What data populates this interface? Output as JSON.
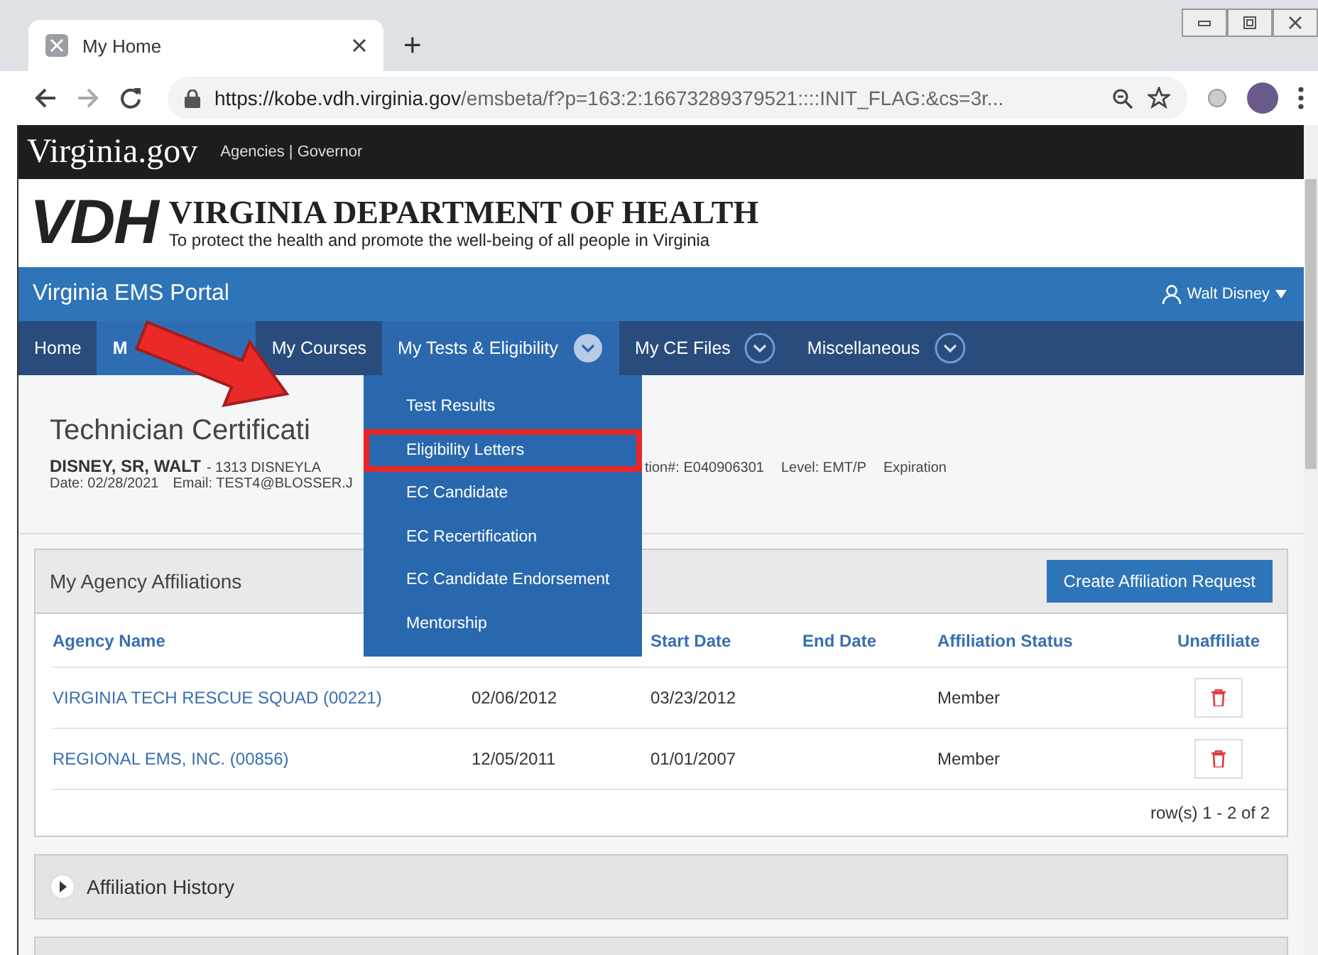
{
  "browser": {
    "tab_title": "My Home",
    "new_tab": "+",
    "url_host": "https://kobe.vdh.virginia.gov",
    "url_path": "/emsbeta/f?p=163:2:16673289379521::::INIT_FLAG:&cs=3r..."
  },
  "top_bar": {
    "logo": "Virginia.gov",
    "links": "Agencies | Governor"
  },
  "header": {
    "logo": "VDH",
    "title": "VIRGINIA DEPARTMENT OF HEALTH",
    "tagline": "To protect the health and promote the well-being of all people in Virginia"
  },
  "portal": {
    "title": "Virginia EMS Portal",
    "user": "Walt Disney"
  },
  "nav": [
    {
      "label": "Home",
      "selected": false,
      "has_menu": false,
      "expanded": false
    },
    {
      "label": "M",
      "selected": true,
      "has_menu": false,
      "expanded": false
    },
    {
      "label": "My Courses",
      "selected": false,
      "has_menu": false,
      "expanded": false
    },
    {
      "label": "My Tests & Eligibility",
      "selected": false,
      "has_menu": true,
      "expanded": true
    },
    {
      "label": "My CE Files",
      "selected": false,
      "has_menu": true,
      "expanded": false
    },
    {
      "label": "Miscellaneous",
      "selected": false,
      "has_menu": true,
      "expanded": false
    }
  ],
  "menu": {
    "items": [
      {
        "label": "Test Results",
        "annotated": false
      },
      {
        "label": "Eligibility Letters",
        "annotated": true
      },
      {
        "label": "EC Candidate",
        "annotated": false
      },
      {
        "label": "EC Recertification",
        "annotated": false
      },
      {
        "label": "EC Candidate Endorsement",
        "annotated": false
      },
      {
        "label": "Mentorship",
        "annotated": false
      }
    ]
  },
  "page": {
    "title": "Technician Certificati",
    "name": "DISNEY, SR, WALT",
    "address": "- 1313 DISNEYLA",
    "details": [
      "tion#: E040906301",
      "Level: EMT/P",
      "Expiration"
    ],
    "date": "Date: 02/28/2021",
    "email": "Email: TEST4@BLOSSER.J"
  },
  "affiliations": {
    "title": "My Agency Affiliations",
    "button": "Create Affiliation Request",
    "columns": [
      "Agency Name",
      "Start Date",
      "End Date",
      "Affiliation Status",
      "Unaffiliate"
    ],
    "rows": [
      {
        "agency": "VIRGINIA TECH RESCUE SQUAD (00221)",
        "column_2": "02/06/2012",
        "start": "03/23/2012",
        "status": "Member"
      },
      {
        "agency": "REGIONAL EMS, INC. (00856)",
        "column_2": "12/05/2011",
        "start": "01/01/2007",
        "status": "Member"
      }
    ],
    "footer": "row(s) 1 - 2 of 2"
  },
  "history": {
    "title": "Affiliation History",
    "expanded": false
  }
}
